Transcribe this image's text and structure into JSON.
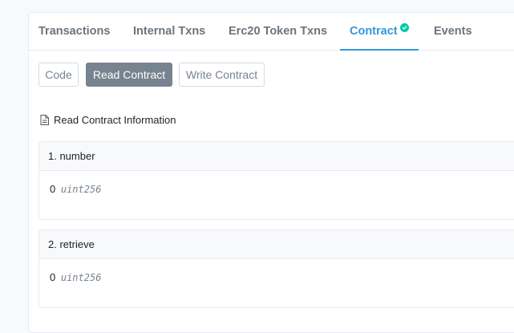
{
  "tabs": [
    {
      "label": "Transactions"
    },
    {
      "label": "Internal Txns"
    },
    {
      "label": "Erc20 Token Txns"
    },
    {
      "label": "Contract",
      "active": true
    },
    {
      "label": "Events"
    }
  ],
  "subtabs": {
    "code": "Code",
    "read": "Read Contract",
    "write": "Write Contract"
  },
  "section": {
    "title": "Read Contract Information",
    "icon": "document-icon"
  },
  "functions": [
    {
      "name": "1. number",
      "value": "0",
      "type": "uint256"
    },
    {
      "name": "2. retrieve",
      "value": "0",
      "type": "uint256"
    }
  ],
  "colors": {
    "accent": "#3498db",
    "verified": "#00c9a7",
    "active_button": "#77838f"
  }
}
